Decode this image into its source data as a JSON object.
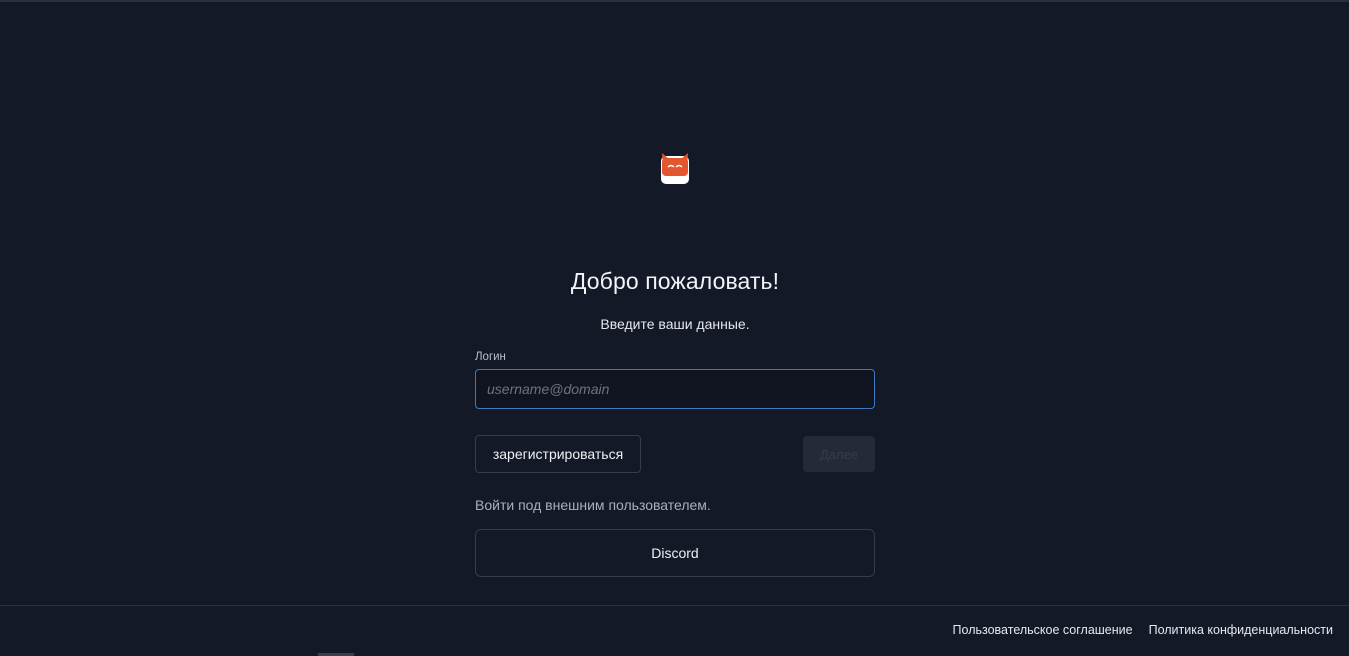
{
  "app": {
    "logo_icon": "fox-icon",
    "accent_color": "#3f78c5",
    "logo_color": "#e4572e"
  },
  "login_form": {
    "title": "Добро пожаловать!",
    "subtitle": "Введите ваши данные.",
    "login_label": "Логин",
    "login_placeholder": "username@domain",
    "login_value": "",
    "register_label": "зарегистрироваться",
    "next_label": "Далее",
    "external_text": "Войти под внешним пользователем.",
    "discord_label": "Discord"
  },
  "footer": {
    "links": [
      {
        "label": "Пользовательское соглашение"
      },
      {
        "label": "Политика конфиденциальности"
      }
    ]
  }
}
